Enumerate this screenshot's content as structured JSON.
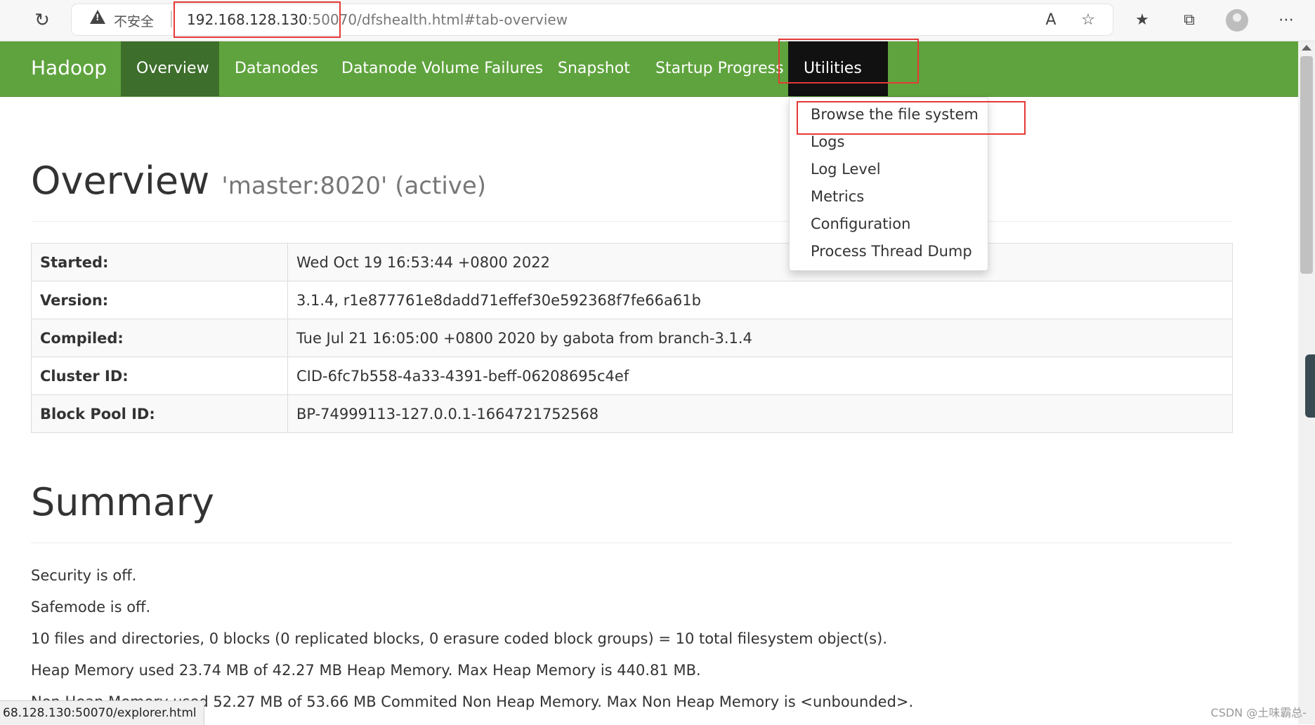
{
  "browser": {
    "security_label": "不安全",
    "url_host": "192.168.128.130",
    "url_port": ":50070",
    "url_path": "/dfshealth.html#tab-overview"
  },
  "navbar": {
    "brand": "Hadoop",
    "items": [
      {
        "label": "Overview"
      },
      {
        "label": "Datanodes"
      },
      {
        "label": "Datanode Volume Failures"
      },
      {
        "label": "Snapshot"
      },
      {
        "label": "Startup Progress"
      },
      {
        "label": "Utilities"
      }
    ]
  },
  "dropdown": {
    "items": [
      "Browse the file system",
      "Logs",
      "Log Level",
      "Metrics",
      "Configuration",
      "Process Thread Dump"
    ]
  },
  "overview": {
    "title": "Overview",
    "subtitle": "'master:8020' (active)",
    "rows": [
      {
        "key": "Started:",
        "value": "Wed Oct 19 16:53:44 +0800 2022"
      },
      {
        "key": "Version:",
        "value": "3.1.4, r1e877761e8dadd71effef30e592368f7fe66a61b"
      },
      {
        "key": "Compiled:",
        "value": "Tue Jul 21 16:05:00 +0800 2020 by gabota from branch-3.1.4"
      },
      {
        "key": "Cluster ID:",
        "value": "CID-6fc7b558-4a33-4391-beff-06208695c4ef"
      },
      {
        "key": "Block Pool ID:",
        "value": "BP-74999113-127.0.0.1-1664721752568"
      }
    ]
  },
  "summary": {
    "title": "Summary",
    "lines": [
      "Security is off.",
      "Safemode is off.",
      "10 files and directories, 0 blocks (0 replicated blocks, 0 erasure coded block groups) = 10 total filesystem object(s).",
      "Heap Memory used 23.74 MB of 42.27 MB Heap Memory. Max Heap Memory is 440.81 MB.",
      "Non Heap Memory used 52.27 MB of 53.66 MB Commited Non Heap Memory. Max Non Heap Memory is <unbounded>."
    ]
  },
  "statusbar": {
    "text": "68.128.130:50070/explorer.html"
  },
  "watermark": {
    "text": "CSDN @土味霸总-"
  }
}
